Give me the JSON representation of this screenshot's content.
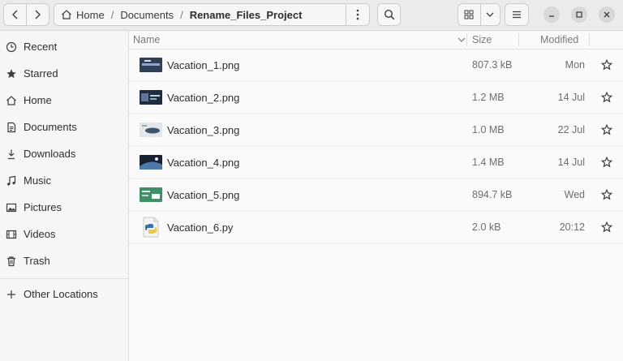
{
  "path": {
    "crumbs": [
      "Home",
      "Documents",
      "Rename_Files_Project"
    ]
  },
  "sidebar": {
    "items": [
      {
        "label": "Recent",
        "icon": "clock-icon"
      },
      {
        "label": "Starred",
        "icon": "star-icon"
      },
      {
        "label": "Home",
        "icon": "home-icon"
      },
      {
        "label": "Documents",
        "icon": "document-icon"
      },
      {
        "label": "Downloads",
        "icon": "download-icon"
      },
      {
        "label": "Music",
        "icon": "music-note-icon"
      },
      {
        "label": "Pictures",
        "icon": "picture-icon"
      },
      {
        "label": "Videos",
        "icon": "film-icon"
      },
      {
        "label": "Trash",
        "icon": "trash-icon"
      }
    ],
    "other": {
      "label": "Other Locations",
      "icon": "plus-icon"
    }
  },
  "columns": {
    "name": "Name",
    "size": "Size",
    "modified": "Modified"
  },
  "files": [
    {
      "name": "Vacation_1.png",
      "size": "807.3 kB",
      "modified": "Mon"
    },
    {
      "name": "Vacation_2.png",
      "size": "1.2 MB",
      "modified": "14 Jul"
    },
    {
      "name": "Vacation_3.png",
      "size": "1.0 MB",
      "modified": "22 Jul"
    },
    {
      "name": "Vacation_4.png",
      "size": "1.4 MB",
      "modified": "14 Jul"
    },
    {
      "name": "Vacation_5.png",
      "size": "894.7 kB",
      "modified": "Wed"
    },
    {
      "name": "Vacation_6.py",
      "size": "2.0 kB",
      "modified": "20:12"
    }
  ]
}
